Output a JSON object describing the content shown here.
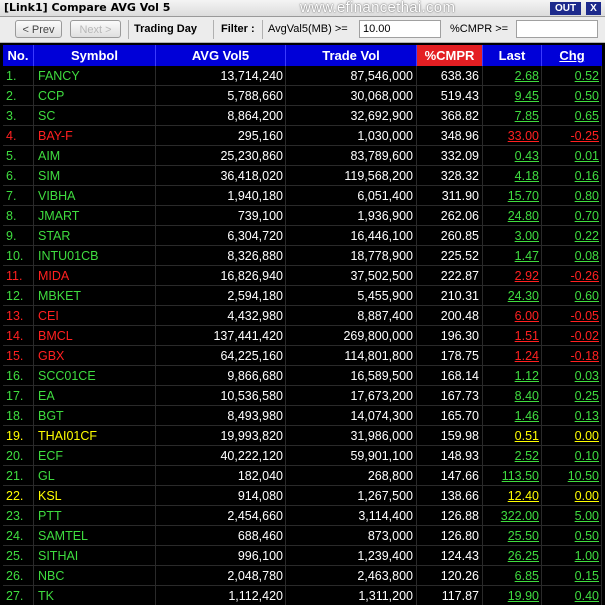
{
  "window": {
    "title": "[Link1] Compare AVG Vol 5",
    "watermark": "www.efinancethai.com",
    "out_label": "OUT",
    "close_label": "X"
  },
  "toolbar": {
    "prev_label": "< Prev",
    "next_label": "Next >",
    "mode_label": "Trading Day",
    "filter_label": "Filter :",
    "avgvol_label": "AvgVal5(MB) >=",
    "avgvol_value": "10.00",
    "cmpr_label": "%CMPR >=",
    "cmpr_value": ""
  },
  "columns": [
    "No.",
    "Symbol",
    "AVG Vol5",
    "Trade Vol",
    "%CMPR",
    "Last",
    "Chg"
  ],
  "colors": {
    "up": "#3fdc3f",
    "down": "#ff2020",
    "unchanged": "#ffff00",
    "header": "#0000d8",
    "cmpr_header": "#e41f23"
  },
  "rows": [
    {
      "no": "1.",
      "symbol": "FANCY",
      "avg": "13,714,240",
      "trade": "87,546,000",
      "cmpr": "638.36",
      "last": "2.68",
      "chg": "0.52",
      "dir": "up"
    },
    {
      "no": "2.",
      "symbol": "CCP",
      "avg": "5,788,660",
      "trade": "30,068,000",
      "cmpr": "519.43",
      "last": "9.45",
      "chg": "0.50",
      "dir": "up"
    },
    {
      "no": "3.",
      "symbol": "SC",
      "avg": "8,864,200",
      "trade": "32,692,900",
      "cmpr": "368.82",
      "last": "7.85",
      "chg": "0.65",
      "dir": "up"
    },
    {
      "no": "4.",
      "symbol": "BAY-F",
      "avg": "295,160",
      "trade": "1,030,000",
      "cmpr": "348.96",
      "last": "33.00",
      "chg": "-0.25",
      "dir": "down"
    },
    {
      "no": "5.",
      "symbol": "AIM",
      "avg": "25,230,860",
      "trade": "83,789,600",
      "cmpr": "332.09",
      "last": "0.43",
      "chg": "0.01",
      "dir": "up"
    },
    {
      "no": "6.",
      "symbol": "SIM",
      "avg": "36,418,020",
      "trade": "119,568,200",
      "cmpr": "328.32",
      "last": "4.18",
      "chg": "0.16",
      "dir": "up"
    },
    {
      "no": "7.",
      "symbol": "VIBHA",
      "avg": "1,940,180",
      "trade": "6,051,400",
      "cmpr": "311.90",
      "last": "15.70",
      "chg": "0.80",
      "dir": "up"
    },
    {
      "no": "8.",
      "symbol": "JMART",
      "avg": "739,100",
      "trade": "1,936,900",
      "cmpr": "262.06",
      "last": "24.80",
      "chg": "0.70",
      "dir": "up"
    },
    {
      "no": "9.",
      "symbol": "STAR",
      "avg": "6,304,720",
      "trade": "16,446,100",
      "cmpr": "260.85",
      "last": "3.00",
      "chg": "0.22",
      "dir": "up"
    },
    {
      "no": "10.",
      "symbol": "INTU01CB",
      "avg": "8,326,880",
      "trade": "18,778,900",
      "cmpr": "225.52",
      "last": "1.47",
      "chg": "0.08",
      "dir": "up"
    },
    {
      "no": "11.",
      "symbol": "MIDA",
      "avg": "16,826,940",
      "trade": "37,502,500",
      "cmpr": "222.87",
      "last": "2.92",
      "chg": "-0.26",
      "dir": "down"
    },
    {
      "no": "12.",
      "symbol": "MBKET",
      "avg": "2,594,180",
      "trade": "5,455,900",
      "cmpr": "210.31",
      "last": "24.30",
      "chg": "0.60",
      "dir": "up"
    },
    {
      "no": "13.",
      "symbol": "CEI",
      "avg": "4,432,980",
      "trade": "8,887,400",
      "cmpr": "200.48",
      "last": "6.00",
      "chg": "-0.05",
      "dir": "down"
    },
    {
      "no": "14.",
      "symbol": "BMCL",
      "avg": "137,441,420",
      "trade": "269,800,000",
      "cmpr": "196.30",
      "last": "1.51",
      "chg": "-0.02",
      "dir": "down"
    },
    {
      "no": "15.",
      "symbol": "GBX",
      "avg": "64,225,160",
      "trade": "114,801,800",
      "cmpr": "178.75",
      "last": "1.24",
      "chg": "-0.18",
      "dir": "down"
    },
    {
      "no": "16.",
      "symbol": "SCC01CE",
      "avg": "9,866,680",
      "trade": "16,589,500",
      "cmpr": "168.14",
      "last": "1.12",
      "chg": "0.03",
      "dir": "up"
    },
    {
      "no": "17.",
      "symbol": "EA",
      "avg": "10,536,580",
      "trade": "17,673,200",
      "cmpr": "167.73",
      "last": "8.40",
      "chg": "0.25",
      "dir": "up"
    },
    {
      "no": "18.",
      "symbol": "BGT",
      "avg": "8,493,980",
      "trade": "14,074,300",
      "cmpr": "165.70",
      "last": "1.46",
      "chg": "0.13",
      "dir": "up"
    },
    {
      "no": "19.",
      "symbol": "THAI01CF",
      "avg": "19,993,820",
      "trade": "31,986,000",
      "cmpr": "159.98",
      "last": "0.51",
      "chg": "0.00",
      "dir": "unchanged"
    },
    {
      "no": "20.",
      "symbol": "ECF",
      "avg": "40,222,120",
      "trade": "59,901,100",
      "cmpr": "148.93",
      "last": "2.52",
      "chg": "0.10",
      "dir": "up"
    },
    {
      "no": "21.",
      "symbol": "GL",
      "avg": "182,040",
      "trade": "268,800",
      "cmpr": "147.66",
      "last": "113.50",
      "chg": "10.50",
      "dir": "up"
    },
    {
      "no": "22.",
      "symbol": "KSL",
      "avg": "914,080",
      "trade": "1,267,500",
      "cmpr": "138.66",
      "last": "12.40",
      "chg": "0.00",
      "dir": "unchanged"
    },
    {
      "no": "23.",
      "symbol": "PTT",
      "avg": "2,454,660",
      "trade": "3,114,400",
      "cmpr": "126.88",
      "last": "322.00",
      "chg": "5.00",
      "dir": "up"
    },
    {
      "no": "24.",
      "symbol": "SAMTEL",
      "avg": "688,460",
      "trade": "873,000",
      "cmpr": "126.80",
      "last": "25.50",
      "chg": "0.50",
      "dir": "up"
    },
    {
      "no": "25.",
      "symbol": "SITHAI",
      "avg": "996,100",
      "trade": "1,239,400",
      "cmpr": "124.43",
      "last": "26.25",
      "chg": "1.00",
      "dir": "up"
    },
    {
      "no": "26.",
      "symbol": "NBC",
      "avg": "2,048,780",
      "trade": "2,463,800",
      "cmpr": "120.26",
      "last": "6.85",
      "chg": "0.15",
      "dir": "up"
    },
    {
      "no": "27.",
      "symbol": "TK",
      "avg": "1,112,420",
      "trade": "1,311,200",
      "cmpr": "117.87",
      "last": "19.90",
      "chg": "0.40",
      "dir": "up"
    }
  ]
}
